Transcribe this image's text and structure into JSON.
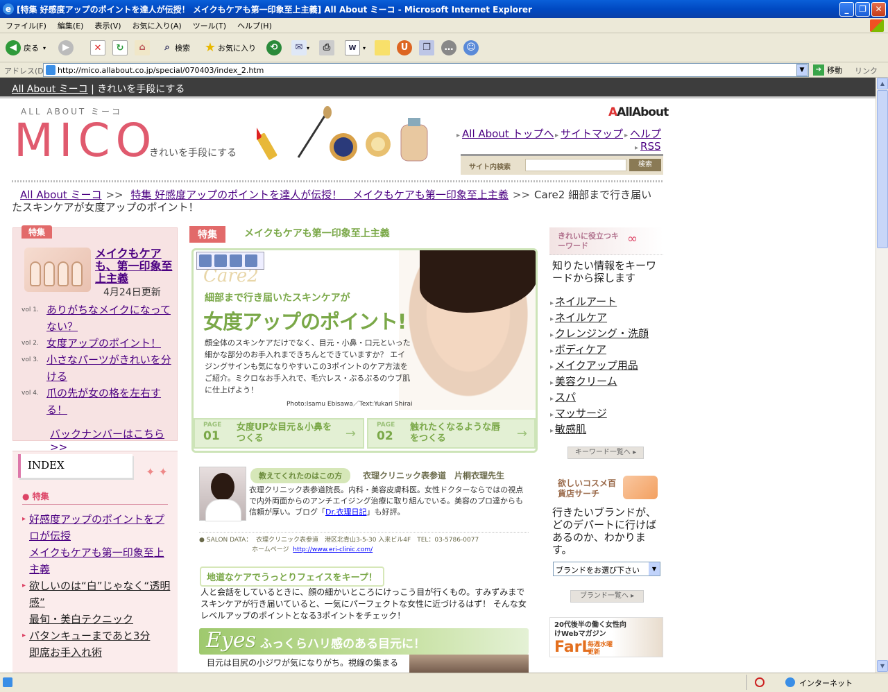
{
  "window": {
    "title": "[特集 好感度アップのポイントを達人が伝授！ メイクもケアも第一印象至上主義] All About ミーコ - Microsoft Internet Explorer"
  },
  "menu": [
    "ファイル(F)",
    "編集(E)",
    "表示(V)",
    "お気に入り(A)",
    "ツール(T)",
    "ヘルプ(H)"
  ],
  "toolbar": {
    "back": "戻る",
    "search": "検索",
    "favorites": "お気に入り"
  },
  "address": {
    "label": "アドレス(D)",
    "url": "http://mico.allabout.co.jp/special/070403/index_2.htm",
    "go": "移動",
    "links": "リンク"
  },
  "status": {
    "zone": "インターネット"
  },
  "page": {
    "stripe": {
      "site": "All About ミーコ",
      "tagline": "| きれいを手段にする"
    },
    "logo": {
      "small": "ALL ABOUT ミーコ",
      "big": "MICO",
      "tag": "きれいを手段にする"
    },
    "brand": "AllAbout",
    "header_nav": [
      "All About トップへ",
      "サイトマップ",
      "ヘルプ",
      "RSS"
    ],
    "search": {
      "label": "サイト内検索",
      "button": "検索"
    },
    "breadcrumb": {
      "home": "All About ミーコ",
      "sep": ">>",
      "feature": "特集 好感度アップのポイントを達人が伝授！　メイクもケアも第一印象至上主義",
      "current": "Care2 細部まで行き届いたスキンケアが女度アップのポイント！"
    },
    "left": {
      "tab": "特集",
      "feature_title": "メイクもケアも、第一印象至上主義",
      "updated": "4月24日更新",
      "vols": [
        {
          "no": "vol 1.",
          "title": "ありがちなメイクになってない？"
        },
        {
          "no": "vol 2.",
          "title": "女度アップのポイント！"
        },
        {
          "no": "vol 3.",
          "title": "小さなパーツがきれいを分ける"
        },
        {
          "no": "vol 4.",
          "title": "爪の先が女の格を左右する！"
        }
      ],
      "back_numbers": "バックナンバーはこちら >>",
      "index_title": "INDEX",
      "index_cat": "特集",
      "index_items": [
        {
          "title": "好感度アップのポイントをプロが伝授",
          "link": true
        },
        {
          "title": "メイクもケアも第一印象至上主義",
          "link": true
        },
        {
          "title": "欲しいのは“白”じゃなく“透明感”",
          "link": false
        },
        {
          "title": "最旬・美白テクニック",
          "link": false
        },
        {
          "title": "パタンキューまであと3分",
          "link": false
        },
        {
          "title": "即席お手入れ術",
          "link": false
        }
      ]
    },
    "center": {
      "tab": "特集",
      "title": "メイクもケアも第一印象至上主義",
      "hero": {
        "care": "Care2",
        "sub": "細部まで行き届いたスキンケアが",
        "big": "女度アップのポイント!",
        "body": "顔全体のスキンケアだけでなく、目元・小鼻・口元といった細かな部分のお手入れまできちんとできていますか？ エイジングサインも気になりやすいこの3ポイントのケア方法をご紹介。ミクロなお手入れで、毛穴レス・ぷるぷるのウブ肌に仕上げよう！",
        "credit": "Photo:Isamu Ebisawa／Text:Yukari Shirai",
        "pages": [
          {
            "label": "PAGE",
            "no": "01",
            "title": "女度UPな目元＆小鼻をつくる"
          },
          {
            "label": "PAGE",
            "no": "02",
            "title": "触れたくなるような唇をつくる"
          }
        ]
      },
      "teacher": {
        "label": "教えてくれたのはこの方",
        "name": "衣理クリニック表参道　片桐衣理先生",
        "desc_a": "衣理クリニック表参道院長。内科・美容皮膚科医。女性ドクターならではの視点で内外両面からのアンチエイジング治療に取り組んでいる。美容のプロ達からも信頼が厚い。ブログ「",
        "blog": "Dr.衣理日記",
        "desc_b": "」も好評。"
      },
      "salon": {
        "label": "SALON DATA：",
        "info": "衣理クリニック表参道　港区北青山3-5-30 入来ビル4F　TEL：03-5786-0077",
        "hp_label": "ホームページ",
        "hp": "http://www.eri-clinic.com/"
      },
      "section_heading": "地道なケアでうっとりフェイスをキープ！",
      "section_text": "人と会話をしているときに、顔の細かいところにけっこう目が行くもの。すみずみまでスキンケアが行き届いていると、一気にパーフェクトな女性に近づけるはず！ そんな女レベルアップのポイントとなる3ポイントをチェック！",
      "eyes_en": "Eyes",
      "eyes_title": "ふっくらハリ感のある目元に！",
      "eyes_text": "目元は目尻の小ジワが気になりがち。視線の集まる"
    },
    "right": {
      "kw_title": "きれいに役立つキーワード",
      "kw_desc": "知りたい情報をキーワードから探します",
      "keywords": [
        "ネイルアート",
        "ネイルケア",
        "クレンジング・洗顔",
        "ボディケア",
        "メイクアップ用品",
        "美容クリーム",
        "スパ",
        "マッサージ",
        "敏感肌"
      ],
      "kw_all": "キーワード一覧へ ▸",
      "cosme_title": "欲しいコスメ百貨店サーチ",
      "cosme_desc": "行きたいブランドが、どのデパートに行けばあるのか、わかります。",
      "brand_select": "ブランドをお選び下さい",
      "brand_all": "ブランド一覧へ ▸",
      "farl": {
        "top": "20代後半の働く女性向けWebマガジン",
        "logo": "FarL",
        "sub": "毎週水曜更新"
      }
    }
  }
}
